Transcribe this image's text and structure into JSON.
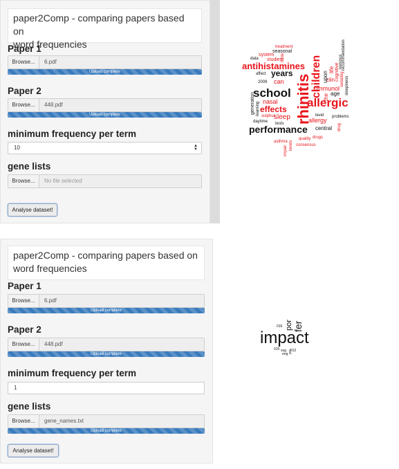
{
  "top": {
    "title_line1": "paper2Comp - comparing papers based on",
    "title_line2": "word frequencies",
    "paper1_label": "Paper 1",
    "paper1_browse": "Browse...",
    "paper1_file": "6.pdf",
    "paper1_progress": "Upload complete",
    "paper2_label": "Paper 2",
    "paper2_browse": "Browse...",
    "paper2_file": "448.pdf",
    "paper2_progress": "Upload complete",
    "minfreq_label": "minimum frequency per term",
    "minfreq_value": "10",
    "gene_label": "gene lists",
    "gene_browse": "Browse...",
    "gene_file_placeholder": "No file selected",
    "analyse_button": "Analyse dataset!"
  },
  "bottom": {
    "title_line1": "paper2Comp - comparing papers based on",
    "title_line2": "word frequencies",
    "paper1_label": "Paper 1",
    "paper1_browse": "Browse...",
    "paper1_file": "6.pdf",
    "paper1_progress": "Upload complete",
    "paper2_label": "Paper 2",
    "paper2_browse": "Browse...",
    "paper2_file": "448.pdf",
    "paper2_progress": "Upload complete",
    "minfreq_label": "minimum frequency per term",
    "minfreq_value": "1",
    "gene_label": "gene lists",
    "gene_browse": "Browse...",
    "gene_file": "gene_names.txt",
    "gene_progress": "Upload complete",
    "analyse_button": "Analyse dataset!"
  },
  "colors": {
    "upload_bar": "#3a7bbd",
    "wordcloud_red": "#e8141b",
    "wordcloud_black": "#111111",
    "panel_bg": "#f5f5f5"
  },
  "wordcloud_top": {
    "words": [
      "rhinitis",
      "school",
      "allergic",
      "children",
      "performance",
      "antihistamines",
      "effects",
      "years",
      "nasal",
      "sleep",
      "allergy",
      "immunol",
      "can",
      "age",
      "clin",
      "life",
      "upon",
      "the",
      "treatment",
      "seasonal",
      "system",
      "studies",
      "data",
      "recommendation",
      "nervous",
      "sedating",
      "sleepiness",
      "cognitive",
      "affect",
      "2009",
      "generation",
      "learning",
      "daytime",
      "sulphur",
      "level",
      "central",
      "problems",
      "tests",
      "drug",
      "drugs",
      "quality",
      "consensus",
      "asthma",
      "levels",
      "table",
      "impair"
    ],
    "red_words": [
      "rhinitis",
      "allergic",
      "children",
      "antihistamines",
      "effects",
      "nasal",
      "sleep",
      "allergy",
      "immunol",
      "can",
      "clin",
      "life",
      "the",
      "treatment",
      "system",
      "studies",
      "table",
      "drug",
      "drugs",
      "quality",
      "consensus",
      "asthma",
      "levels",
      "sulphur",
      "impair",
      "sedating"
    ]
  },
  "wordcloud_bottom": {
    "words": [
      "impact",
      "fer",
      "por",
      "eng",
      "pro",
      "sug",
      "016",
      "015",
      "012"
    ]
  }
}
